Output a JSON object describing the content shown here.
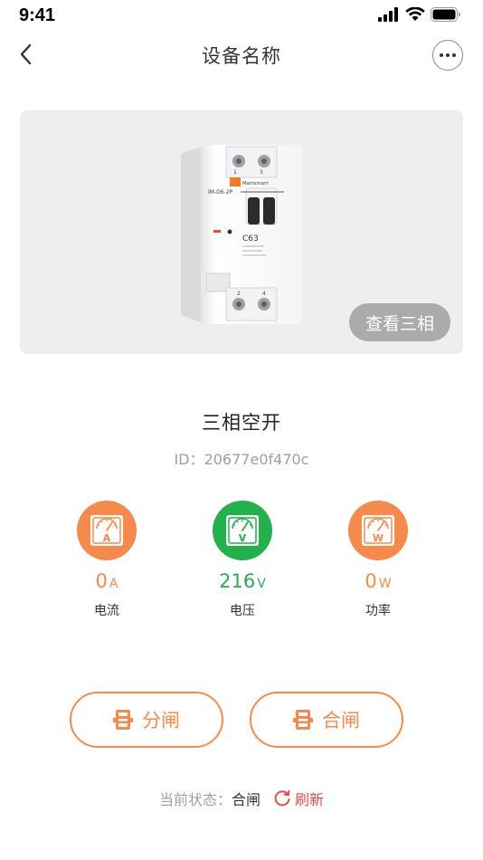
{
  "status_bar": {
    "time": "9:41"
  },
  "nav": {
    "title": "设备名称"
  },
  "device": {
    "view_phases_label": "查看三相",
    "name": "三相空开",
    "id_text": "ID：20677e0f470c",
    "breaker_brand": "Martsmart",
    "breaker_model": "IM-D6-2P",
    "breaker_rating": "C63"
  },
  "meters": [
    {
      "icon": "ammeter-icon",
      "letter": "A",
      "value": "0",
      "unit": "A",
      "label": "电流",
      "color": "#f58a4b"
    },
    {
      "icon": "voltmeter-icon",
      "letter": "V",
      "value": "216",
      "unit": "V",
      "label": "电压",
      "color": "#22b14c"
    },
    {
      "icon": "wattmeter-icon",
      "letter": "W",
      "value": "0",
      "unit": "W",
      "label": "功率",
      "color": "#f58a4b"
    }
  ],
  "actions": {
    "open_label": "分闸",
    "close_label": "合闸",
    "accent_color": "#f58a4b"
  },
  "status": {
    "label": "当前状态：",
    "value": "合闸",
    "refresh_label": "刷新"
  }
}
